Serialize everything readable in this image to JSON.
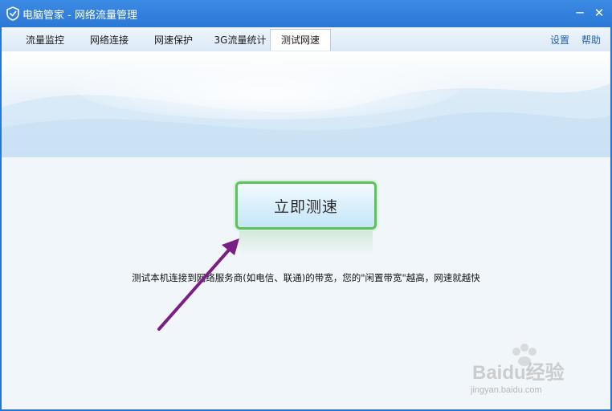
{
  "window": {
    "title": "电脑管家 - 网络流量管理",
    "minimize_symbol": "─",
    "close_symbol": "✕"
  },
  "tabs": [
    {
      "label": "流量监控"
    },
    {
      "label": "网络连接"
    },
    {
      "label": "网速保护"
    },
    {
      "label": "3G流量统计"
    },
    {
      "label": "测试网速",
      "active": true
    }
  ],
  "header_links": {
    "settings": "设置",
    "help": "帮助"
  },
  "main": {
    "speed_test_button": "立即测速",
    "description": "测试本机连接到网络服务商(如电信、联通)的带宽，您的\"闲置带宽\"越高，网速就越快"
  },
  "watermark": {
    "brand": "Baidu经验",
    "url": "jingyan.baidu.com"
  },
  "colors": {
    "titlebar": "#2c78d6",
    "button_border": "#5dc25a",
    "arrow": "#7b1f86",
    "link": "#1f5fb7"
  }
}
